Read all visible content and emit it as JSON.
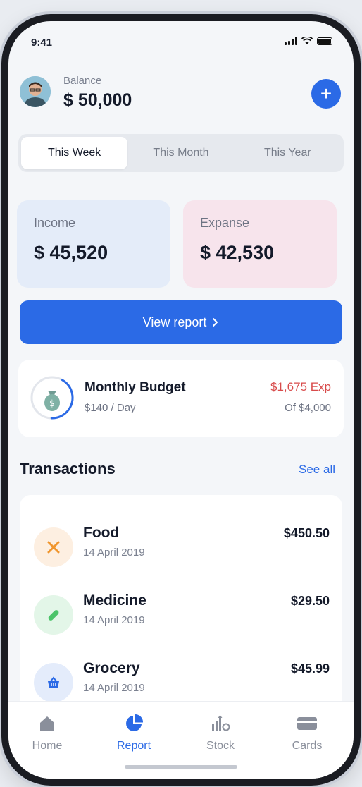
{
  "status": {
    "time": "9:41"
  },
  "header": {
    "balance_label": "Balance",
    "balance_value": "$ 50,000",
    "add_label": "+"
  },
  "period_tabs": [
    {
      "label": "This Week",
      "active": true
    },
    {
      "label": "This Month",
      "active": false
    },
    {
      "label": "This Year",
      "active": false
    }
  ],
  "summary": {
    "income_label": "Income",
    "income_value": "$ 45,520",
    "expense_label": "Expanse",
    "expense_value": "$ 42,530"
  },
  "view_report": {
    "label": "View report",
    "icon": "chevron-right-icon"
  },
  "budget": {
    "title": "Monthly Budget",
    "per_day": "$140 / Day",
    "expense": "$1,675 Exp",
    "of_total": "Of $4,000",
    "icon": "money-bag-icon",
    "progress_fraction": 0.42
  },
  "transactions": {
    "title": "Transactions",
    "see_all": "See all",
    "items": [
      {
        "name": "Food",
        "date": "14 April 2019",
        "amount": "$450.50",
        "icon": "utensils-icon"
      },
      {
        "name": "Medicine",
        "date": "14 April 2019",
        "amount": "$29.50",
        "icon": "pill-icon"
      },
      {
        "name": "Grocery",
        "date": "14 April 2019",
        "amount": "$45.99",
        "icon": "basket-icon"
      }
    ]
  },
  "tab_bar": [
    {
      "label": "Home",
      "icon": "home-icon",
      "active": false
    },
    {
      "label": "Report",
      "icon": "pie-chart-icon",
      "active": true
    },
    {
      "label": "Stock",
      "icon": "stock-icon",
      "active": false
    },
    {
      "label": "Cards",
      "icon": "card-icon",
      "active": false
    }
  ],
  "colors": {
    "accent": "#2b6ae6",
    "income_bg": "#e4ecf9",
    "expense_bg": "#f7e4ec",
    "expense_text": "#d84b4b"
  }
}
